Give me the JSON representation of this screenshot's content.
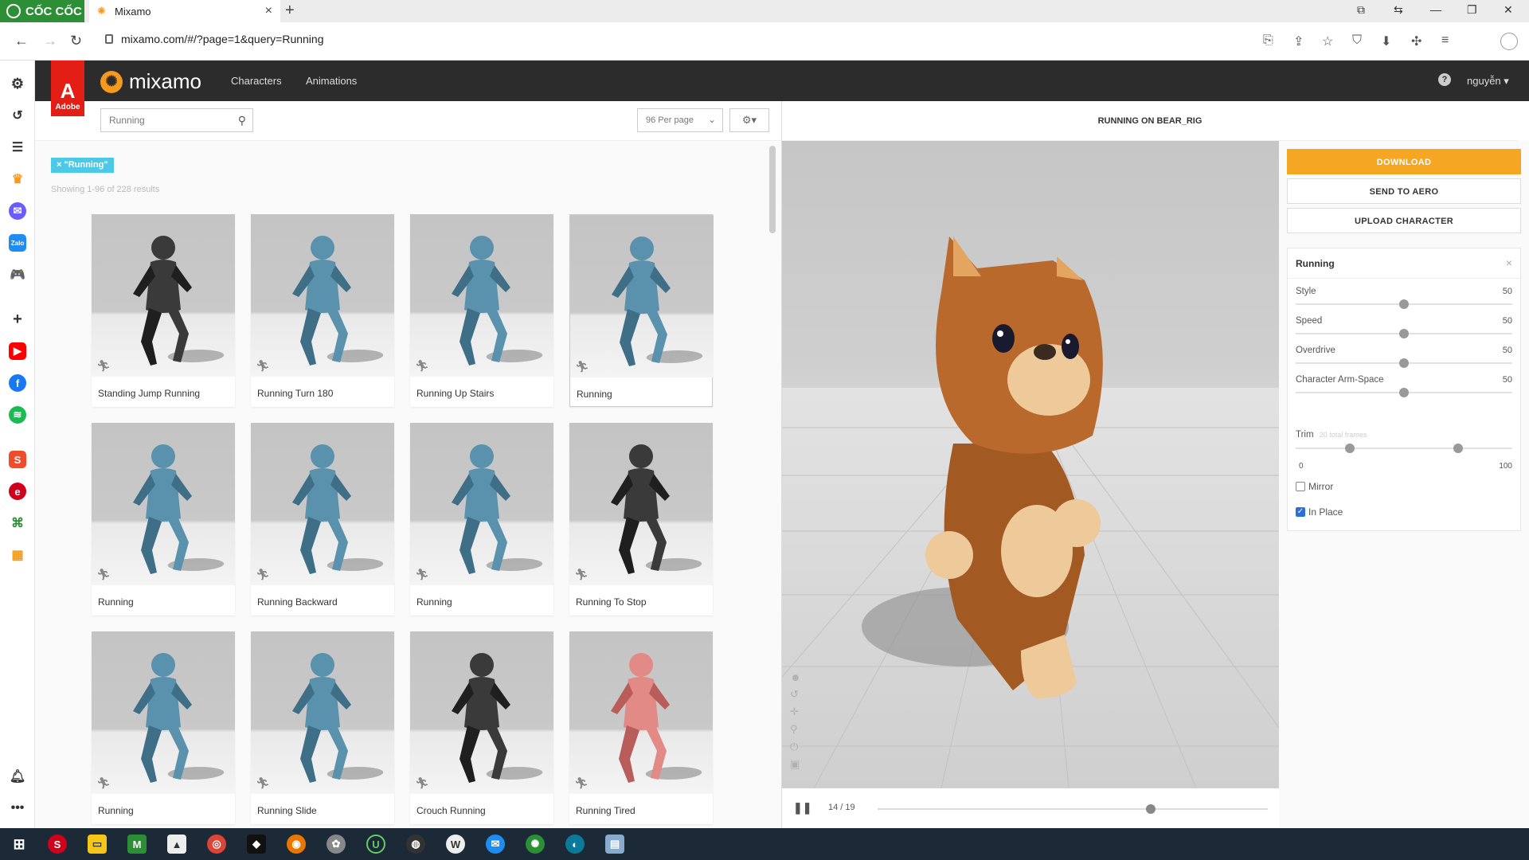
{
  "browser": {
    "brand": "CỐC CỐC",
    "tab_title": "Mixamo",
    "tab_close": "×",
    "new_tab": "+",
    "url": "mixamo.com/#/?page=1&query=Running"
  },
  "header": {
    "adobe_label": "Adobe",
    "logo_text": "mixamo",
    "nav": [
      "Characters",
      "Animations"
    ],
    "help": "?",
    "user": "nguyễn ▾"
  },
  "search": {
    "value": "Running",
    "per_page": "96 Per page",
    "filter_chip": "× \"Running\"",
    "showing": "Showing 1-96 of 228 results"
  },
  "cards": [
    {
      "label": "Standing Jump Running",
      "figure": "dark"
    },
    {
      "label": "Running Turn 180",
      "figure": "blue"
    },
    {
      "label": "Running Up Stairs",
      "figure": "blue"
    },
    {
      "label": "Running",
      "figure": "blue"
    },
    {
      "label": "Running",
      "figure": "blue"
    },
    {
      "label": "Running Backward",
      "figure": "blue"
    },
    {
      "label": "Running",
      "figure": "blue"
    },
    {
      "label": "Running To Stop",
      "figure": "dark"
    },
    {
      "label": "Running",
      "figure": "blue"
    },
    {
      "label": "Running Slide",
      "figure": "blue"
    },
    {
      "label": "Crouch Running",
      "figure": "dark"
    },
    {
      "label": "Running Tired",
      "figure": "pink"
    }
  ],
  "viewer": {
    "title": "RUNNING ON BEAR_RIG",
    "frame": "14 / 19",
    "progress": 0.7
  },
  "actions": {
    "download": "DOWNLOAD",
    "send": "SEND TO AERO",
    "upload": "UPLOAD CHARACTER"
  },
  "settings": {
    "title": "Running",
    "close": "×",
    "sliders": [
      {
        "label": "Style",
        "value": "50",
        "level": 0.5
      },
      {
        "label": "Speed",
        "value": "50",
        "level": 0.5
      },
      {
        "label": "Overdrive",
        "value": "50",
        "level": 0.5
      },
      {
        "label": "Character Arm-Space",
        "value": "50",
        "level": 0.5
      }
    ],
    "trim_label": "Trim",
    "trim_note": "20 total frames",
    "trim_min": "0",
    "trim_max": "100",
    "trim_range": [
      0.25,
      0.75
    ],
    "mirror": {
      "label": "Mirror",
      "checked": false
    },
    "in_place": {
      "label": "In Place",
      "checked": true
    }
  },
  "colors": {
    "accent": "#f5a623",
    "chip": "#4cc9e6",
    "header": "#2c2c2c",
    "adobe": "#e31e14"
  }
}
